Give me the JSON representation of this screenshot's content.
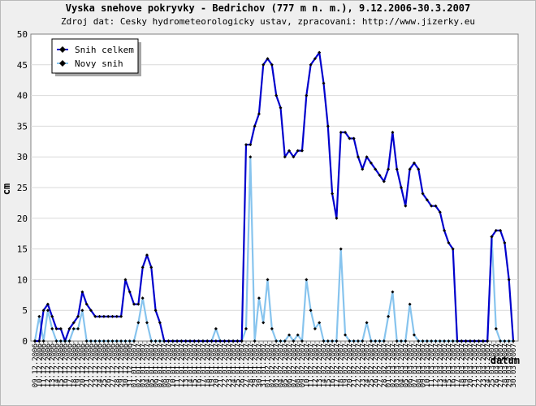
{
  "chart_data": {
    "type": "line",
    "title": "Vyska snehove pokryvky - Bedrichov (777 m n. m.), 9.12.2006-30.3.2007",
    "subtitle": "Zdroj dat: Cesky hydrometeorologicky ustav, zpracovani: http://www.jizerky.eu",
    "xlabel": "datum",
    "ylabel": "cm",
    "ylim": [
      0,
      50
    ],
    "yticks": [
      0,
      5,
      10,
      15,
      20,
      25,
      30,
      35,
      40,
      45,
      50
    ],
    "grid": true,
    "legend_position": "top-left",
    "colors": {
      "snih_celkem": "#0000cc",
      "novy_snih": "#87c4ee",
      "marker": "#000000",
      "background": "#efefef",
      "plot": "#ffffff"
    },
    "x": [
      "09.12.2006",
      "10.12.2006",
      "11.12.2006",
      "12.12.2006",
      "13.12.2006",
      "14.12.2006",
      "15.12.2006",
      "16.12.2006",
      "17.12.2006",
      "18.12.2006",
      "19.12.2006",
      "20.12.2006",
      "21.12.2006",
      "22.12.2006",
      "23.12.2006",
      "24.12.2006",
      "25.12.2006",
      "26.12.2006",
      "27.12.2006",
      "28.12.2006",
      "29.12.2006",
      "30.12.2006",
      "31.12.2006",
      "01.01.2007",
      "02.01.2007",
      "03.01.2007",
      "04.01.2007",
      "05.01.2007",
      "06.01.2007",
      "07.01.2007",
      "08.01.2007",
      "09.01.2007",
      "10.01.2007",
      "11.01.2007",
      "12.01.2007",
      "13.01.2007",
      "14.01.2007",
      "15.01.2007",
      "16.01.2007",
      "17.01.2007",
      "18.01.2007",
      "19.01.2007",
      "20.01.2007",
      "21.01.2007",
      "22.01.2007",
      "23.01.2007",
      "24.01.2007",
      "25.01.2007",
      "26.01.2007",
      "27.01.2007",
      "28.01.2007",
      "29.01.2007",
      "30.01.2007",
      "31.01.2007",
      "01.02.2007",
      "02.02.2007",
      "03.02.2007",
      "04.02.2007",
      "05.02.2007",
      "06.02.2007",
      "07.02.2007",
      "08.02.2007",
      "09.02.2007",
      "10.02.2007",
      "11.02.2007",
      "12.02.2007",
      "13.02.2007",
      "14.02.2007",
      "15.02.2007",
      "16.02.2007",
      "17.02.2007",
      "18.02.2007",
      "19.02.2007",
      "20.02.2007",
      "21.02.2007",
      "22.02.2007",
      "23.02.2007",
      "24.02.2007",
      "25.02.2007",
      "26.02.2007",
      "27.02.2007",
      "28.02.2007",
      "01.03.2007",
      "02.03.2007",
      "03.03.2007",
      "04.03.2007",
      "05.03.2007",
      "06.03.2007",
      "07.03.2007",
      "08.03.2007",
      "09.03.2007",
      "10.03.2007",
      "11.03.2007",
      "12.03.2007",
      "13.03.2007",
      "14.03.2007",
      "15.03.2007",
      "16.03.2007",
      "17.03.2007",
      "18.03.2007",
      "19.03.2007",
      "20.03.2007",
      "21.03.2007",
      "22.03.2007",
      "23.03.2007",
      "24.03.2007",
      "25.03.2007",
      "26.03.2007",
      "27.03.2007",
      "28.03.2007",
      "29.03.2007",
      "30.03.2007"
    ],
    "series": [
      {
        "name": "Snih celkem",
        "values": [
          0,
          0,
          5,
          6,
          4,
          2,
          2,
          0,
          2,
          3,
          4,
          8,
          6,
          5,
          4,
          4,
          4,
          4,
          4,
          4,
          4,
          10,
          8,
          6,
          6,
          12,
          14,
          12,
          5,
          3,
          0,
          0,
          0,
          0,
          0,
          0,
          0,
          0,
          0,
          0,
          0,
          0,
          0,
          0,
          0,
          0,
          0,
          0,
          0,
          32,
          32,
          35,
          37,
          45,
          46,
          45,
          40,
          38,
          30,
          31,
          30,
          31,
          31,
          40,
          45,
          46,
          47,
          42,
          35,
          24,
          20,
          34,
          34,
          33,
          33,
          30,
          28,
          30,
          29,
          28,
          27,
          26,
          28,
          34,
          28,
          25,
          22,
          28,
          29,
          28,
          24,
          23,
          22,
          22,
          21,
          18,
          16,
          15,
          0,
          0,
          0,
          0,
          0,
          0,
          0,
          0,
          17,
          18,
          18,
          16,
          10,
          0
        ]
      },
      {
        "name": "Novy snih",
        "values": [
          0,
          4,
          0,
          5,
          2,
          0,
          0,
          0,
          0,
          2,
          2,
          5,
          0,
          0,
          0,
          0,
          0,
          0,
          0,
          0,
          0,
          0,
          0,
          0,
          3,
          7,
          3,
          0,
          0,
          0,
          0,
          0,
          0,
          0,
          0,
          0,
          0,
          0,
          0,
          0,
          0,
          0,
          2,
          0,
          0,
          0,
          0,
          0,
          0,
          2,
          30,
          0,
          7,
          3,
          10,
          2,
          0,
          0,
          0,
          1,
          0,
          1,
          0,
          10,
          5,
          2,
          3,
          0,
          0,
          0,
          0,
          15,
          1,
          0,
          0,
          0,
          0,
          3,
          0,
          0,
          0,
          0,
          4,
          8,
          0,
          0,
          0,
          6,
          1,
          0,
          0,
          0,
          0,
          0,
          0,
          0,
          0,
          0,
          0,
          0,
          0,
          0,
          0,
          0,
          0,
          0,
          17,
          2,
          0,
          0,
          0,
          0
        ]
      }
    ]
  }
}
